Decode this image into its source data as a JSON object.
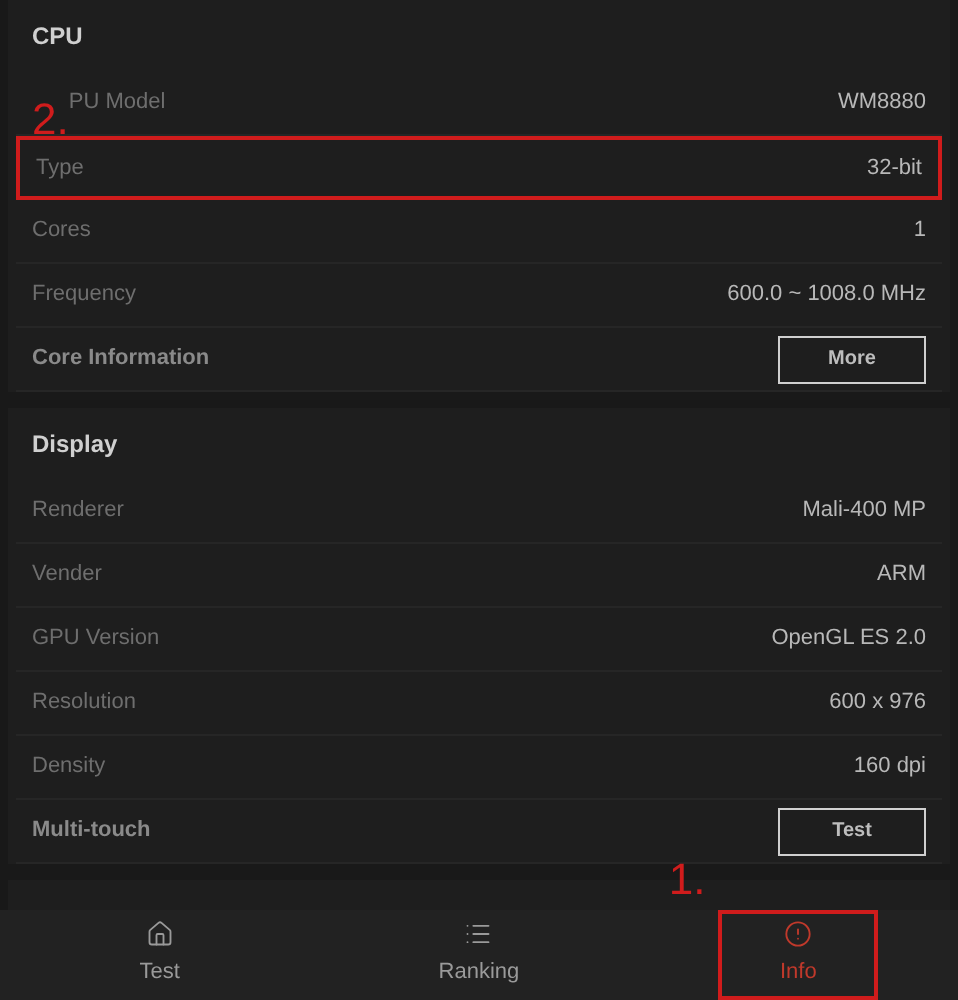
{
  "sections": [
    {
      "title": "CPU",
      "rows": [
        {
          "kind": "value",
          "label": "PU Model",
          "value": "WM8880",
          "annotation": "2.",
          "highlighted": false
        },
        {
          "kind": "value",
          "label": "Type",
          "value": "32-bit",
          "highlighted": true
        },
        {
          "kind": "value",
          "label": "Cores",
          "value": "1",
          "highlighted": false
        },
        {
          "kind": "value",
          "label": "Frequency",
          "value": "600.0 ~ 1008.0 MHz",
          "highlighted": false
        },
        {
          "kind": "button",
          "label": "Core Information",
          "value": "More",
          "highlighted": false
        }
      ]
    },
    {
      "title": "Display",
      "rows": [
        {
          "kind": "value",
          "label": "Renderer",
          "value": "Mali-400 MP",
          "highlighted": false
        },
        {
          "kind": "value",
          "label": "Vender",
          "value": "ARM",
          "highlighted": false
        },
        {
          "kind": "value",
          "label": "GPU Version",
          "value": "OpenGL ES 2.0",
          "highlighted": false
        },
        {
          "kind": "value",
          "label": "Resolution",
          "value": "600 x 976",
          "highlighted": false
        },
        {
          "kind": "value",
          "label": "Density",
          "value": "160 dpi",
          "highlighted": false
        },
        {
          "kind": "button",
          "label": "Multi-touch",
          "value": "Test",
          "highlighted": false
        }
      ]
    }
  ],
  "nav": [
    {
      "label": "Test",
      "selected": false,
      "highlighted": false
    },
    {
      "label": "Ranking",
      "selected": false,
      "highlighted": false
    },
    {
      "label": "Info",
      "selected": true,
      "highlighted": true,
      "annotation": "1."
    }
  ]
}
